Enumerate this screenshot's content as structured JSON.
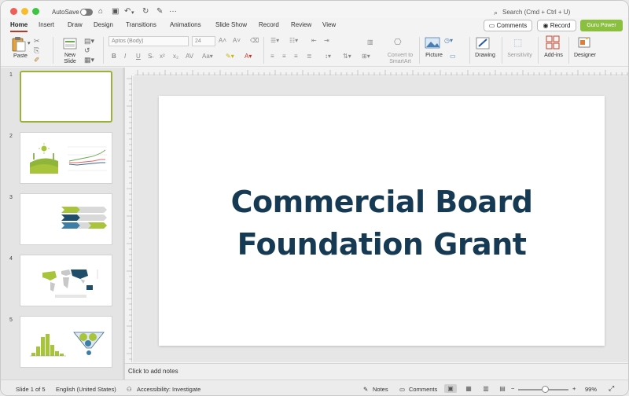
{
  "titlebar": {
    "autosave_label": "AutoSave",
    "search_placeholder": "Search (Cmd + Ctrl + U)"
  },
  "tabs": [
    "Home",
    "Insert",
    "Draw",
    "Design",
    "Transitions",
    "Animations",
    "Slide Show",
    "Record",
    "Review",
    "View"
  ],
  "active_tab": "Home",
  "header_buttons": {
    "comments": "Comments",
    "record": "Record",
    "guru": "Guru Power"
  },
  "ribbon": {
    "paste": "Paste",
    "new_slide": "New\nSlide",
    "font_name": "Aptos (Body)",
    "font_size": "24",
    "convert_smartart": "Convert to\nSmartArt",
    "picture": "Picture",
    "drawing": "Drawing",
    "sensitivity": "Sensitivity",
    "addins": "Add-ins",
    "designer": "Designer"
  },
  "slides": [
    {
      "number": "1"
    },
    {
      "number": "2"
    },
    {
      "number": "3"
    },
    {
      "number": "4"
    },
    {
      "number": "5"
    }
  ],
  "slide": {
    "title_line1": "Commercial Board",
    "title_line2": "Foundation Grant"
  },
  "notes_placeholder": "Click to add notes",
  "status": {
    "slide_position": "Slide 1 of 5",
    "language": "English (United States)",
    "accessibility": "Accessibility: Investigate",
    "notes": "Notes",
    "comments": "Comments",
    "zoom": "99%"
  },
  "colors": {
    "title": "#163a53",
    "accent_green": "#8bbf3f",
    "tab_underline": "#b63a26",
    "selected_thumb": "#9bb13a"
  }
}
